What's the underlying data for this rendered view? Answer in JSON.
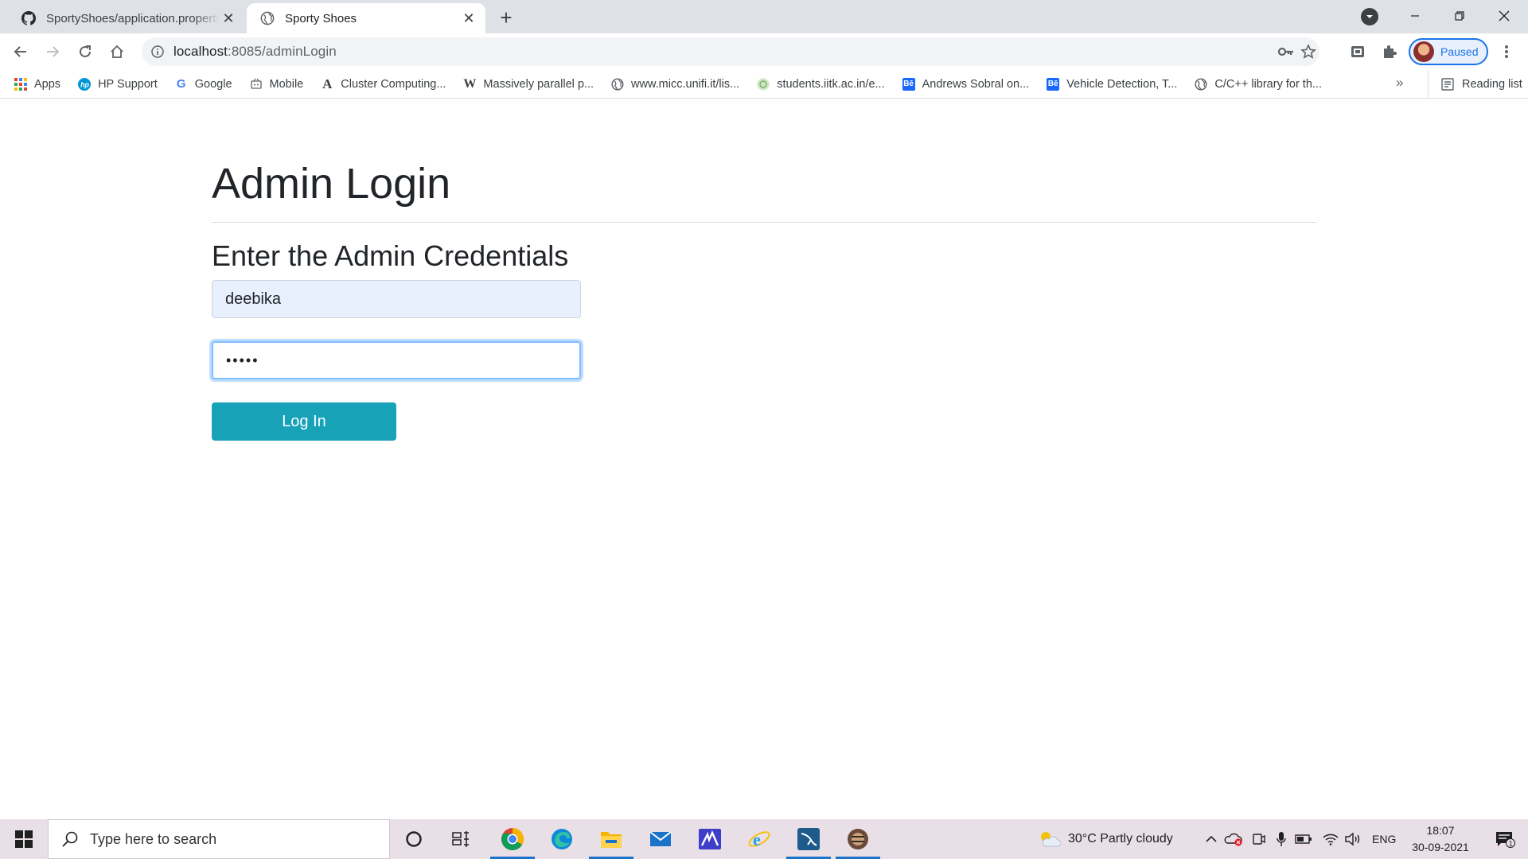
{
  "browser": {
    "tabs": [
      {
        "title": "SportyShoes/application.properti",
        "icon": "github-icon",
        "active": false
      },
      {
        "title": "Sporty Shoes",
        "icon": "globe-icon",
        "active": true
      }
    ],
    "url_host": "localhost",
    "url_path": ":8085/adminLogin",
    "profile_label": "Paused",
    "bookmarks": [
      {
        "label": "Apps",
        "icon": "apps-grid-icon"
      },
      {
        "label": "HP Support",
        "icon": "hp-icon"
      },
      {
        "label": "Google",
        "icon": "google-icon"
      },
      {
        "label": "Mobile",
        "icon": "mobile-icon"
      },
      {
        "label": "Cluster Computing...",
        "icon": "font-a-icon"
      },
      {
        "label": "Massively parallel p...",
        "icon": "wikipedia-icon"
      },
      {
        "label": "www.micc.unifi.it/lis...",
        "icon": "globe-icon"
      },
      {
        "label": "students.iitk.ac.in/e...",
        "icon": "iitk-icon"
      },
      {
        "label": "Andrews Sobral on...",
        "icon": "behance-icon"
      },
      {
        "label": "Vehicle Detection, T...",
        "icon": "behance-icon"
      },
      {
        "label": "C/C++ library for th...",
        "icon": "globe-icon"
      }
    ],
    "more_bookmarks": "»",
    "reading_list": "Reading list"
  },
  "page": {
    "title": "Admin Login",
    "subtitle": "Enter the Admin Credentials",
    "username_value": "deebika",
    "password_masked": "•••••",
    "login_button": "Log In"
  },
  "taskbar": {
    "search_placeholder": "Type here to search",
    "weather": "30°C  Partly cloudy",
    "language": "ENG",
    "time": "18:07",
    "date": "30-09-2021",
    "notification_count": "1"
  },
  "colors": {
    "login_button": "#17a2b8",
    "focus_border": "#80bdff",
    "autofill_bg": "#e8f0fe",
    "taskbar": "#e9dfe7"
  }
}
